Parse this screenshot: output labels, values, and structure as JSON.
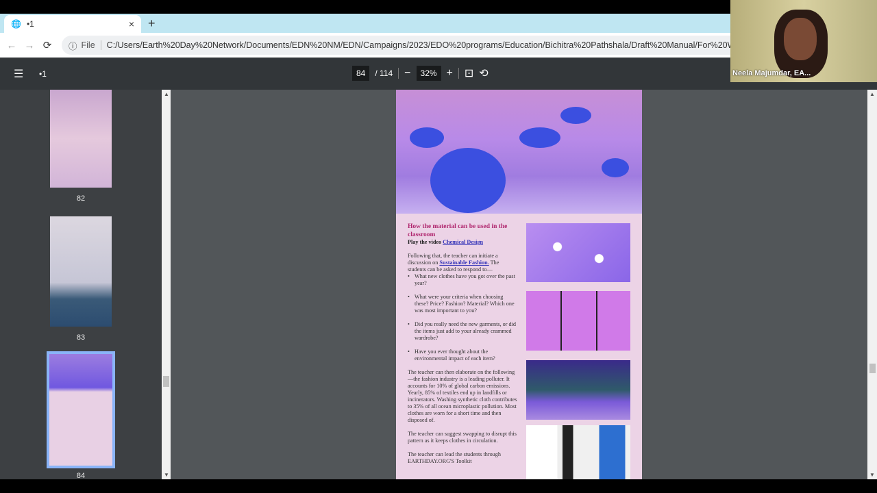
{
  "browser": {
    "tab_title": "•1",
    "url_scheme_label": "File",
    "url": "C:/Users/Earth%20Day%20Network/Documents/EDN%20NM/EDN/Campaigns/2023/EDO%20programs/Education/Bichitra%20Pathshala/Draft%20Manual/For%20WYSIWYG/Wysi..."
  },
  "pdf_toolbar": {
    "title": "•1",
    "current_page": "84",
    "total_pages": "/ 114",
    "zoom": "32%"
  },
  "thumbnails": [
    {
      "label": "82"
    },
    {
      "label": "83"
    },
    {
      "label": "84",
      "selected": true
    }
  ],
  "page": {
    "heading": "How the material can be used in the classroom",
    "video_prefix": "Play the video ",
    "video_link": "Chemical Design",
    "intro_1": "Following that, the teacher can initiate a discussion on ",
    "intro_link": "Sustainable Fashion.",
    "intro_2": " The students can be asked to respond to—",
    "bullets": [
      "What new clothes have you got over the past year?",
      "What were your criteria when choosing these? Price? Fashion? Material? Which one was most important to you?",
      "Did you really need the new garments, or did the items just add to your already crammed wardrobe?",
      "Have you ever thought about the environmental impact of each item?"
    ],
    "para_1": "The teacher can then elaborate on the following—the fashion industry is a leading polluter. It accounts for 10% of global carbon emissions. Yearly, 85% of textiles end up in landfills or incinerators. Washing synthetic cloth contributes to 35% of all ocean microplastic pollution. Most clothes are worn for a short time and then disposed of.",
    "para_2": "The teacher can suggest swapping to disrupt this pattern as it keeps clothes in circulation.",
    "para_3": "The teacher can lead the students through EARTHDAY.ORG'S Toolkit"
  },
  "webcam": {
    "participant_name": "Neela Majumdar, EA..."
  },
  "colors": {
    "tabstrip": "#bfe6f2",
    "toolbar": "#323639",
    "viewer_bg": "#525659",
    "heading": "#b0286f",
    "link": "#3434b8",
    "page_bg": "#ecd3e6"
  }
}
